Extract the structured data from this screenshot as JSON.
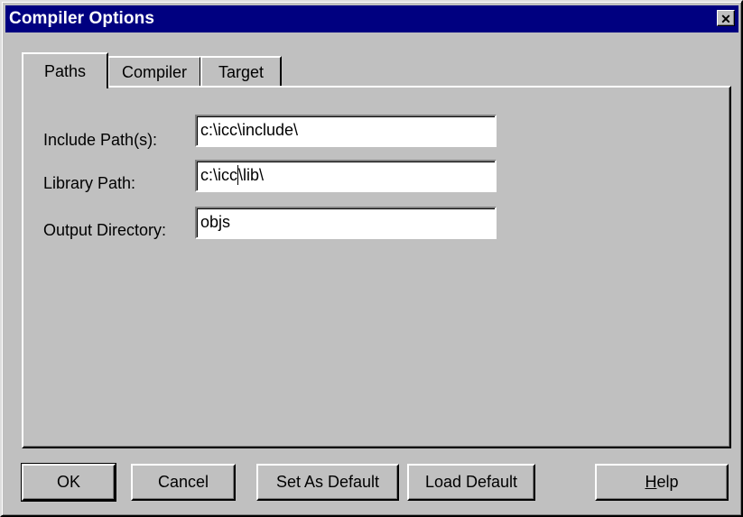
{
  "window": {
    "title": "Compiler Options",
    "close_glyph": "✕"
  },
  "tabs": [
    {
      "label": "Paths",
      "active": true
    },
    {
      "label": "Compiler",
      "active": false
    },
    {
      "label": "Target",
      "active": false
    }
  ],
  "fields": {
    "include": {
      "label": "Include Path(s):",
      "value": "c:\\icc\\include\\"
    },
    "library": {
      "label": "Library Path:",
      "value_before_caret": "c:\\icc",
      "value_after_caret": "\\lib\\"
    },
    "output": {
      "label": "Output Directory:",
      "value": "objs"
    }
  },
  "buttons": {
    "ok": "OK",
    "cancel": "Cancel",
    "set_default": "Set As Default",
    "load_default": "Load Default",
    "help": "Help"
  },
  "colors": {
    "face": "#c0c0c0",
    "titlebar": "#000080",
    "title_text": "#ffffff"
  },
  "icons": {
    "close": "close-icon"
  }
}
